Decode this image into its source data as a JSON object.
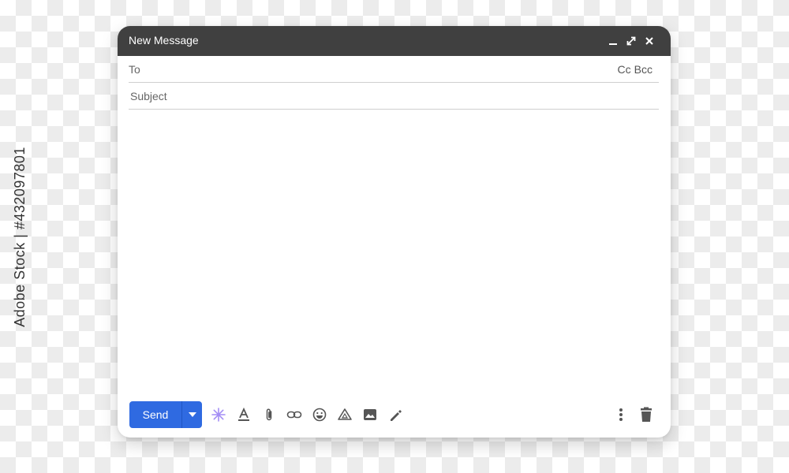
{
  "watermark": "Adobe Stock | #432097801",
  "window": {
    "title": "New Message",
    "controls": [
      "minimize-icon",
      "expand-icon",
      "close-icon"
    ]
  },
  "compose": {
    "to_label": "To",
    "to_value": "",
    "cc_label": "Cc",
    "bcc_label": "Bcc",
    "subject_placeholder": "Subject",
    "subject_value": "",
    "body_value": ""
  },
  "toolbar": {
    "send_label": "Send",
    "send_color": "#2f6ae1",
    "tools": [
      "ai-assist-icon",
      "formatting-icon",
      "attach-icon",
      "link-icon",
      "emoji-icon",
      "drive-icon",
      "image-icon",
      "signature-icon"
    ],
    "right_tools": [
      "more-options-icon",
      "trash-icon"
    ]
  },
  "colors": {
    "titlebar": "#404040",
    "accent_purple": "#a48ef5"
  }
}
